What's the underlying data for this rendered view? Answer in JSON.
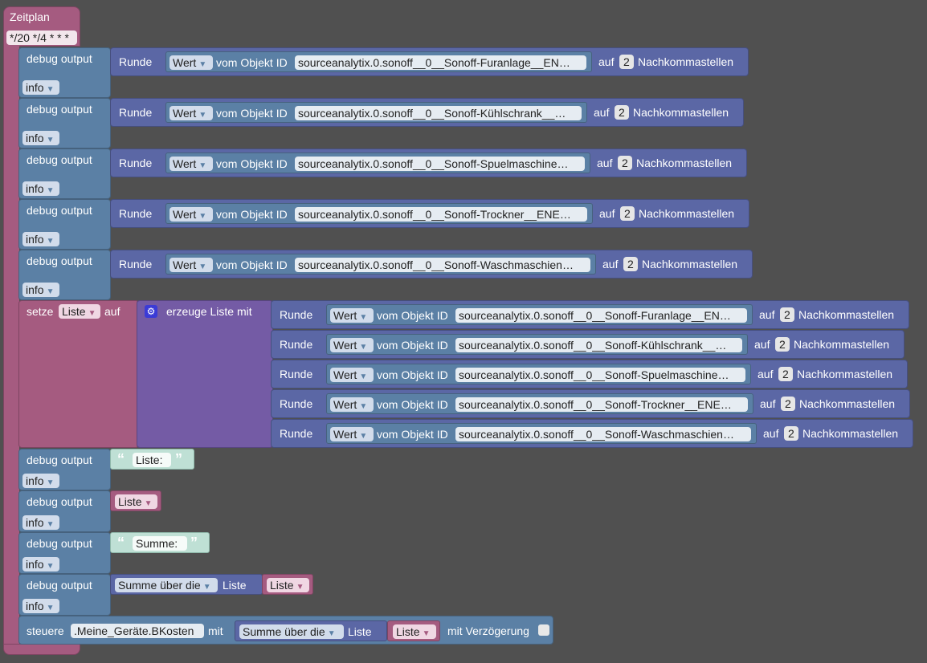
{
  "event": {
    "title": "Zeitplan",
    "cron": "*/20 */4 * * *"
  },
  "labels": {
    "debug_output": "debug output",
    "info": "info",
    "runde": "Runde",
    "wert": "Wert",
    "vom_objekt_id": "vom Objekt ID",
    "auf": "auf",
    "nachkommastellen": "Nachkommastellen",
    "setze": "setze",
    "erzeuge_liste_mit": "erzeuge Liste mit",
    "summe_ueber_die": "Summe über die",
    "liste": "Liste",
    "steuere": "steuere",
    "mit": "mit",
    "mit_verzoegerung": "mit Verzögerung"
  },
  "debug_rounds": [
    {
      "object_id": "sourceanalytix.0.sonoff__0__Sonoff-Furanlage__EN…",
      "decimals": "2"
    },
    {
      "object_id": "sourceanalytix.0.sonoff__0__Sonoff-Kühlschrank__…",
      "decimals": "2"
    },
    {
      "object_id": "sourceanalytix.0.sonoff__0__Sonoff-Spuelmaschine…",
      "decimals": "2"
    },
    {
      "object_id": "sourceanalytix.0.sonoff__0__Sonoff-Trockner__ENE…",
      "decimals": "2"
    },
    {
      "object_id": "sourceanalytix.0.sonoff__0__Sonoff-Waschmaschien…",
      "decimals": "2"
    }
  ],
  "set_variable": "Liste",
  "list_items": [
    {
      "object_id": "sourceanalytix.0.sonoff__0__Sonoff-Furanlage__EN…",
      "decimals": "2"
    },
    {
      "object_id": "sourceanalytix.0.sonoff__0__Sonoff-Kühlschrank__…",
      "decimals": "2"
    },
    {
      "object_id": "sourceanalytix.0.sonoff__0__Sonoff-Spuelmaschine…",
      "decimals": "2"
    },
    {
      "object_id": "sourceanalytix.0.sonoff__0__Sonoff-Trockner__ENE…",
      "decimals": "2"
    },
    {
      "object_id": "sourceanalytix.0.sonoff__0__Sonoff-Waschmaschien…",
      "decimals": "2"
    }
  ],
  "text_liste": "Liste:",
  "text_summe": "Summe:",
  "steuere_target": ".Meine_Geräte.BKosten",
  "colors": {
    "background": "#505050",
    "event": "#a55b80",
    "debug": "#5b80a5",
    "math_round": "#5b67a5",
    "list": "#745ba5",
    "text": "#bfe0d5"
  }
}
